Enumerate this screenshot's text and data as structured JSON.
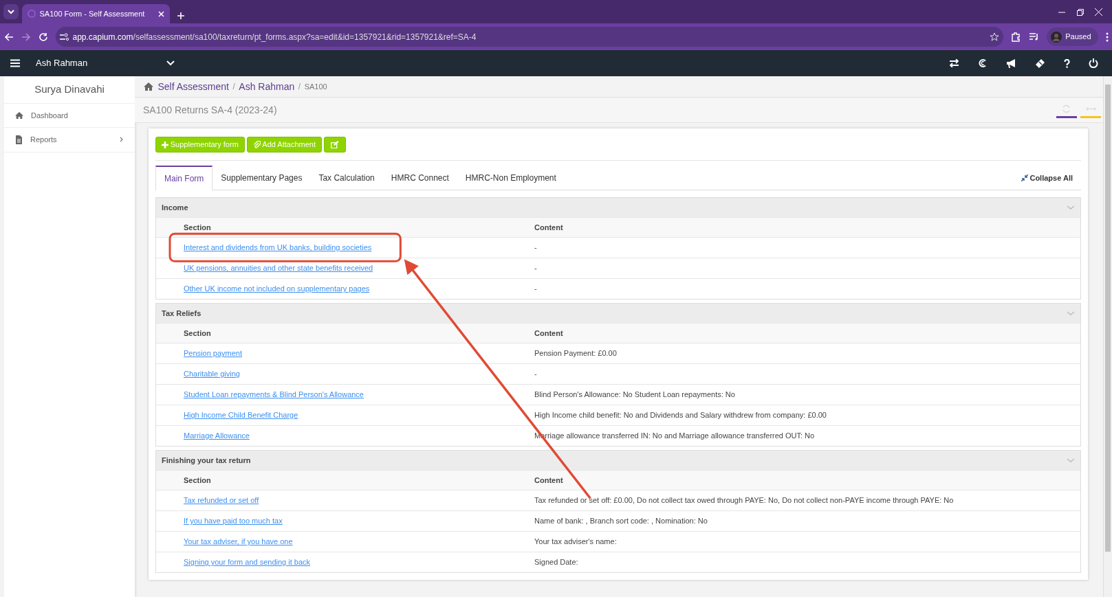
{
  "browser": {
    "tab_title": "SA100 Form - Self Assessment",
    "url_host": "app.capium.com",
    "url_path": "/selfassessment/sa100/taxreturn/pt_forms.aspx?sa=edit&id=1357921&rid=1357921&ref=SA-4",
    "profile_label": "Paused"
  },
  "navbar": {
    "client": "Ash Rahman"
  },
  "sidebar": {
    "user": "Surya Dinavahi",
    "items": [
      {
        "label": "Dashboard",
        "kind": "link"
      },
      {
        "label": "Reports",
        "kind": "submenu"
      }
    ]
  },
  "breadcrumb": [
    {
      "label": "Self Assessment",
      "kind": "link"
    },
    {
      "label": "/",
      "kind": "separator"
    },
    {
      "label": "Ash Rahman",
      "kind": "link"
    },
    {
      "label": "/",
      "kind": "separator"
    },
    {
      "label": "SA100",
      "kind": "current"
    }
  ],
  "page_title": "SA100 Returns SA-4 (2023-24)",
  "toolbar": [
    {
      "label": "Supplementary form",
      "kind": "plus"
    },
    {
      "label": "Add Attachment",
      "kind": "clip"
    },
    {
      "kind": "edit"
    }
  ],
  "tabs": [
    {
      "label": "Main Form",
      "selected": true
    },
    {
      "label": "Supplementary Pages",
      "selected": false
    },
    {
      "label": "Tax Calculation",
      "selected": false
    },
    {
      "label": "HMRC Connect",
      "selected": false
    },
    {
      "label": "HMRC-Non Employment",
      "selected": false
    }
  ],
  "collapse_all": "Collapse All",
  "sections": [
    {
      "title": "Income",
      "columns": [
        "Section",
        "Content"
      ],
      "rows": [
        {
          "section": "Interest and dividends from UK banks, building societies",
          "content": "-",
          "highlighted": true
        },
        {
          "section": "UK pensions, annuities and other state benefits received",
          "content": "-",
          "highlighted": false
        },
        {
          "section": "Other UK income not included on supplementary pages",
          "content": "-",
          "highlighted": false
        }
      ]
    },
    {
      "title": "Tax Reliefs",
      "columns": [
        "Section",
        "Content"
      ],
      "rows": [
        {
          "section": "Pension payment",
          "content": "Pension Payment: £0.00",
          "highlighted": false
        },
        {
          "section": "Charitable giving",
          "content": "-",
          "highlighted": false
        },
        {
          "section": "Student Loan repayments & Blind Person's Allowance",
          "content": "Blind Person's Allowance: No Student Loan repayments: No",
          "highlighted": false
        },
        {
          "section": "High Income Child Benefit Charge",
          "content": "High Income child benefit: No and Dividends and Salary withdrew from company: £0.00",
          "highlighted": false
        },
        {
          "section": "Marriage Allowance",
          "content": "Marriage allowance transferred IN: No and Marriage allowance transferred OUT: No",
          "highlighted": false
        }
      ]
    },
    {
      "title": "Finishing your tax return",
      "columns": [
        "Section",
        "Content"
      ],
      "rows": [
        {
          "section": "Tax refunded or set off",
          "content": "Tax refunded or set off: £0.00, Do not collect tax owed through PAYE: No, Do not collect non-PAYE income through PAYE: No",
          "highlighted": false
        },
        {
          "section": "If you have paid too much tax",
          "content": "Name of bank: , Branch sort code: , Nomination: No",
          "highlighted": false
        },
        {
          "section": "Your tax adviser, if you have one",
          "content": "Your tax adviser's name:",
          "highlighted": false
        },
        {
          "section": "Signing your form and sending it back",
          "content": "Signed Date:",
          "highlighted": false
        }
      ]
    }
  ]
}
